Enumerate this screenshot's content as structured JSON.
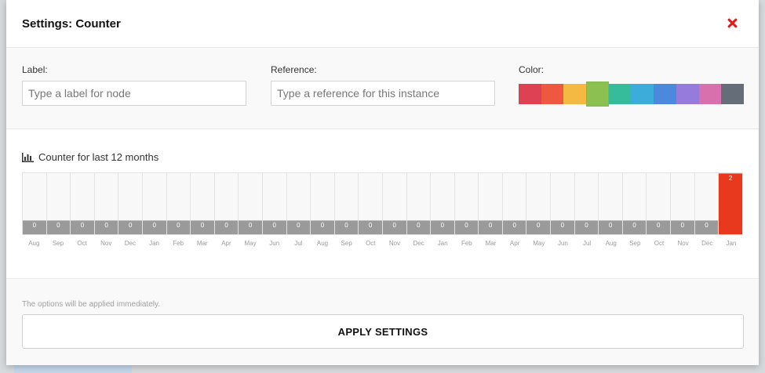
{
  "modal": {
    "title": "Settings: Counter"
  },
  "form": {
    "label_field": {
      "label": "Label:",
      "placeholder": "Type a label for node",
      "value": ""
    },
    "reference_field": {
      "label": "Reference:",
      "placeholder": "Type a reference for this instance",
      "value": ""
    },
    "color": {
      "label": "Color:",
      "swatches": [
        "#de4152",
        "#ee5840",
        "#f4b942",
        "#8cc152",
        "#36bc9b",
        "#3caddb",
        "#4a89dc",
        "#967adc",
        "#d870ad",
        "#656d78"
      ],
      "selected_index": 3
    }
  },
  "chart": {
    "title": "Counter for last 12 months",
    "icon": "bar-chart-icon"
  },
  "chart_data": {
    "type": "bar",
    "title": "Counter for last 12 months",
    "categories": [
      "Aug",
      "Sep",
      "Oct",
      "Nov",
      "Dec",
      "Jan",
      "Feb",
      "Mar",
      "Apr",
      "May",
      "Jun",
      "Jul",
      "Aug",
      "Sep",
      "Oct",
      "Nov",
      "Dec",
      "Jan",
      "Feb",
      "Mar",
      "Apr",
      "May",
      "Jun",
      "Jul",
      "Aug",
      "Sep",
      "Oct",
      "Nov",
      "Dec",
      "Jan"
    ],
    "values": [
      0,
      0,
      0,
      0,
      0,
      0,
      0,
      0,
      0,
      0,
      0,
      0,
      0,
      0,
      0,
      0,
      0,
      0,
      0,
      0,
      0,
      0,
      0,
      0,
      0,
      0,
      0,
      0,
      0,
      2
    ],
    "active_color": "#e8391e",
    "inactive_color": "#9a9a9a"
  },
  "footer": {
    "note": "The options will be applied immediately.",
    "apply_label": "APPLY SETTINGS"
  }
}
